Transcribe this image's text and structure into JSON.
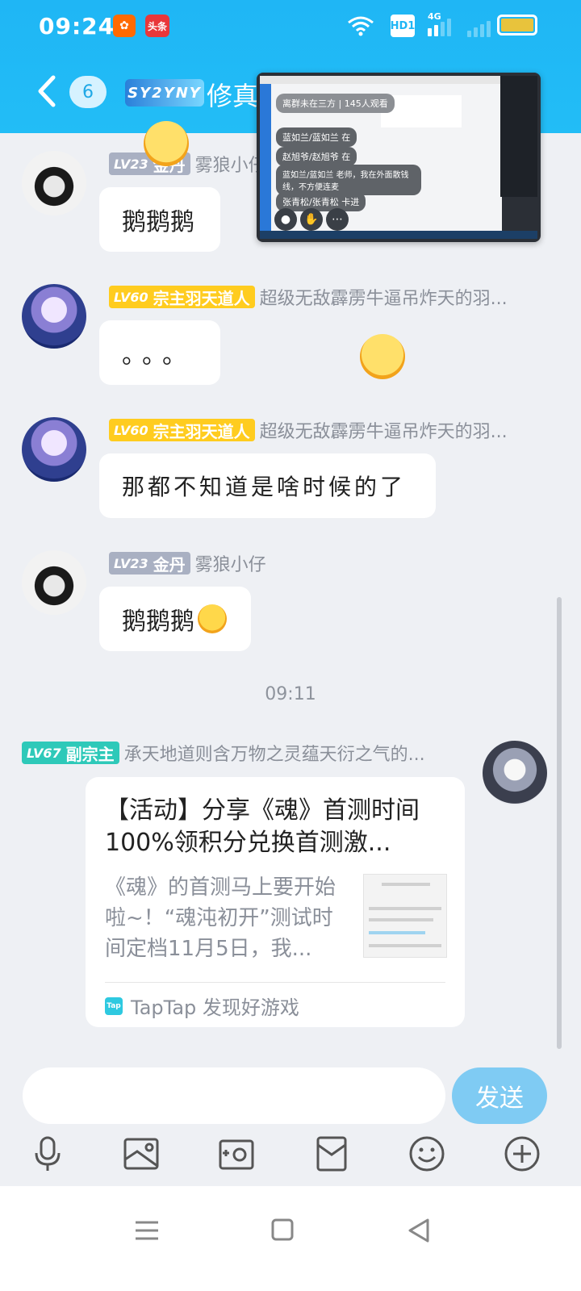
{
  "status_bar": {
    "time": "09:24",
    "app_icon_1": "kuaishou-icon",
    "app_icon_2": "toutiao-icon",
    "app_icon_2_label": "头条",
    "network_hd": "HD1",
    "network_4g": "4G"
  },
  "header": {
    "unread_count": "6",
    "group_logo": "SY2YNY",
    "title": "修真"
  },
  "mini_window": {
    "messages": [
      "离群未在三方 | 145人观看",
      "蓝如兰/蓝如兰  在",
      "赵旭爷/赵旭爷  在",
      "蓝如兰/蓝如兰  老师，我在外面散钱线，不方便连麦",
      "张青松/张青松  卡进"
    ]
  },
  "messages": [
    {
      "level": "LV23",
      "rank": "金丹",
      "nickname": "雾狼小仔",
      "text": "鹅鹅鹅"
    },
    {
      "level": "LV60",
      "rank": "宗主羽天道人",
      "nickname": "超级无敌霹雳牛逼吊炸天的羽...",
      "text": "。。。"
    },
    {
      "level": "LV60",
      "rank": "宗主羽天道人",
      "nickname": "超级无敌霹雳牛逼吊炸天的羽...",
      "text": "那都不知道是啥时候的了"
    },
    {
      "level": "LV23",
      "rank": "金丹",
      "nickname": "雾狼小仔",
      "text": "鹅鹅鹅"
    }
  ],
  "timestamp": "09:11",
  "shared_card": {
    "level": "LV67",
    "rank": "副宗主",
    "nickname": "承天地道则含万物之灵蕴天衍之气的...",
    "title": "【活动】分享《魂》首测时间 100%领积分兑换首测激...",
    "description": "《魂》的首测马上要开始啦~！“魂沌初开”测试时间定档11月5日，我...",
    "source": "TapTap 发现好游戏",
    "source_icon_label": "Tap"
  },
  "input": {
    "placeholder": "",
    "send_label": "发送"
  },
  "toolbar": [
    "microphone-icon",
    "image-icon",
    "camera-icon",
    "red-packet-icon",
    "emoji-icon",
    "plus-icon"
  ],
  "colors": {
    "header": "#1fb6f5",
    "send": "#7fcbf3",
    "badge_gold": "#ffcc1f",
    "badge_gray": "#a9b0c2",
    "badge_teal": "#2ec9b9"
  }
}
